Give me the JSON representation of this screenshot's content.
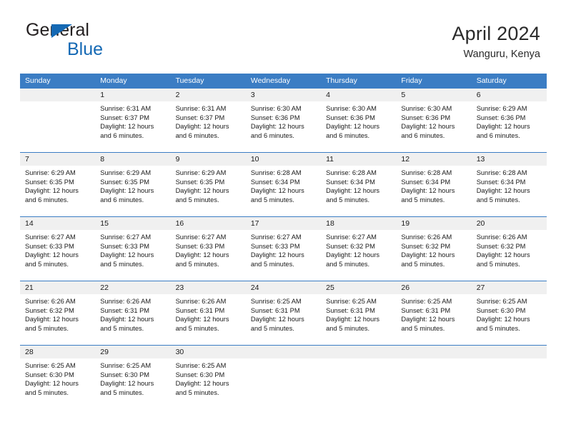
{
  "brand": {
    "name_part1": "General",
    "name_part2": "Blue",
    "accent_color": "#1569b4"
  },
  "header": {
    "title": "April 2024",
    "subtitle": "Wanguru, Kenya"
  },
  "theme": {
    "header_blue": "#3b7dc4",
    "date_band_gray": "#f0f0f0"
  },
  "weekday_headers": [
    "Sunday",
    "Monday",
    "Tuesday",
    "Wednesday",
    "Thursday",
    "Friday",
    "Saturday"
  ],
  "weeks": [
    {
      "days": [
        {
          "day": "",
          "sunrise": "",
          "sunset": "",
          "daylight_line1": "",
          "daylight_line2": "",
          "empty": true
        },
        {
          "day": "1",
          "sunrise": "Sunrise: 6:31 AM",
          "sunset": "Sunset: 6:37 PM",
          "daylight_line1": "Daylight: 12 hours",
          "daylight_line2": "and 6 minutes.",
          "empty": false
        },
        {
          "day": "2",
          "sunrise": "Sunrise: 6:31 AM",
          "sunset": "Sunset: 6:37 PM",
          "daylight_line1": "Daylight: 12 hours",
          "daylight_line2": "and 6 minutes.",
          "empty": false
        },
        {
          "day": "3",
          "sunrise": "Sunrise: 6:30 AM",
          "sunset": "Sunset: 6:36 PM",
          "daylight_line1": "Daylight: 12 hours",
          "daylight_line2": "and 6 minutes.",
          "empty": false
        },
        {
          "day": "4",
          "sunrise": "Sunrise: 6:30 AM",
          "sunset": "Sunset: 6:36 PM",
          "daylight_line1": "Daylight: 12 hours",
          "daylight_line2": "and 6 minutes.",
          "empty": false
        },
        {
          "day": "5",
          "sunrise": "Sunrise: 6:30 AM",
          "sunset": "Sunset: 6:36 PM",
          "daylight_line1": "Daylight: 12 hours",
          "daylight_line2": "and 6 minutes.",
          "empty": false
        },
        {
          "day": "6",
          "sunrise": "Sunrise: 6:29 AM",
          "sunset": "Sunset: 6:36 PM",
          "daylight_line1": "Daylight: 12 hours",
          "daylight_line2": "and 6 minutes.",
          "empty": false
        }
      ]
    },
    {
      "days": [
        {
          "day": "7",
          "sunrise": "Sunrise: 6:29 AM",
          "sunset": "Sunset: 6:35 PM",
          "daylight_line1": "Daylight: 12 hours",
          "daylight_line2": "and 6 minutes.",
          "empty": false
        },
        {
          "day": "8",
          "sunrise": "Sunrise: 6:29 AM",
          "sunset": "Sunset: 6:35 PM",
          "daylight_line1": "Daylight: 12 hours",
          "daylight_line2": "and 6 minutes.",
          "empty": false
        },
        {
          "day": "9",
          "sunrise": "Sunrise: 6:29 AM",
          "sunset": "Sunset: 6:35 PM",
          "daylight_line1": "Daylight: 12 hours",
          "daylight_line2": "and 5 minutes.",
          "empty": false
        },
        {
          "day": "10",
          "sunrise": "Sunrise: 6:28 AM",
          "sunset": "Sunset: 6:34 PM",
          "daylight_line1": "Daylight: 12 hours",
          "daylight_line2": "and 5 minutes.",
          "empty": false
        },
        {
          "day": "11",
          "sunrise": "Sunrise: 6:28 AM",
          "sunset": "Sunset: 6:34 PM",
          "daylight_line1": "Daylight: 12 hours",
          "daylight_line2": "and 5 minutes.",
          "empty": false
        },
        {
          "day": "12",
          "sunrise": "Sunrise: 6:28 AM",
          "sunset": "Sunset: 6:34 PM",
          "daylight_line1": "Daylight: 12 hours",
          "daylight_line2": "and 5 minutes.",
          "empty": false
        },
        {
          "day": "13",
          "sunrise": "Sunrise: 6:28 AM",
          "sunset": "Sunset: 6:34 PM",
          "daylight_line1": "Daylight: 12 hours",
          "daylight_line2": "and 5 minutes.",
          "empty": false
        }
      ]
    },
    {
      "days": [
        {
          "day": "14",
          "sunrise": "Sunrise: 6:27 AM",
          "sunset": "Sunset: 6:33 PM",
          "daylight_line1": "Daylight: 12 hours",
          "daylight_line2": "and 5 minutes.",
          "empty": false
        },
        {
          "day": "15",
          "sunrise": "Sunrise: 6:27 AM",
          "sunset": "Sunset: 6:33 PM",
          "daylight_line1": "Daylight: 12 hours",
          "daylight_line2": "and 5 minutes.",
          "empty": false
        },
        {
          "day": "16",
          "sunrise": "Sunrise: 6:27 AM",
          "sunset": "Sunset: 6:33 PM",
          "daylight_line1": "Daylight: 12 hours",
          "daylight_line2": "and 5 minutes.",
          "empty": false
        },
        {
          "day": "17",
          "sunrise": "Sunrise: 6:27 AM",
          "sunset": "Sunset: 6:33 PM",
          "daylight_line1": "Daylight: 12 hours",
          "daylight_line2": "and 5 minutes.",
          "empty": false
        },
        {
          "day": "18",
          "sunrise": "Sunrise: 6:27 AM",
          "sunset": "Sunset: 6:32 PM",
          "daylight_line1": "Daylight: 12 hours",
          "daylight_line2": "and 5 minutes.",
          "empty": false
        },
        {
          "day": "19",
          "sunrise": "Sunrise: 6:26 AM",
          "sunset": "Sunset: 6:32 PM",
          "daylight_line1": "Daylight: 12 hours",
          "daylight_line2": "and 5 minutes.",
          "empty": false
        },
        {
          "day": "20",
          "sunrise": "Sunrise: 6:26 AM",
          "sunset": "Sunset: 6:32 PM",
          "daylight_line1": "Daylight: 12 hours",
          "daylight_line2": "and 5 minutes.",
          "empty": false
        }
      ]
    },
    {
      "days": [
        {
          "day": "21",
          "sunrise": "Sunrise: 6:26 AM",
          "sunset": "Sunset: 6:32 PM",
          "daylight_line1": "Daylight: 12 hours",
          "daylight_line2": "and 5 minutes.",
          "empty": false
        },
        {
          "day": "22",
          "sunrise": "Sunrise: 6:26 AM",
          "sunset": "Sunset: 6:31 PM",
          "daylight_line1": "Daylight: 12 hours",
          "daylight_line2": "and 5 minutes.",
          "empty": false
        },
        {
          "day": "23",
          "sunrise": "Sunrise: 6:26 AM",
          "sunset": "Sunset: 6:31 PM",
          "daylight_line1": "Daylight: 12 hours",
          "daylight_line2": "and 5 minutes.",
          "empty": false
        },
        {
          "day": "24",
          "sunrise": "Sunrise: 6:25 AM",
          "sunset": "Sunset: 6:31 PM",
          "daylight_line1": "Daylight: 12 hours",
          "daylight_line2": "and 5 minutes.",
          "empty": false
        },
        {
          "day": "25",
          "sunrise": "Sunrise: 6:25 AM",
          "sunset": "Sunset: 6:31 PM",
          "daylight_line1": "Daylight: 12 hours",
          "daylight_line2": "and 5 minutes.",
          "empty": false
        },
        {
          "day": "26",
          "sunrise": "Sunrise: 6:25 AM",
          "sunset": "Sunset: 6:31 PM",
          "daylight_line1": "Daylight: 12 hours",
          "daylight_line2": "and 5 minutes.",
          "empty": false
        },
        {
          "day": "27",
          "sunrise": "Sunrise: 6:25 AM",
          "sunset": "Sunset: 6:30 PM",
          "daylight_line1": "Daylight: 12 hours",
          "daylight_line2": "and 5 minutes.",
          "empty": false
        }
      ]
    },
    {
      "days": [
        {
          "day": "28",
          "sunrise": "Sunrise: 6:25 AM",
          "sunset": "Sunset: 6:30 PM",
          "daylight_line1": "Daylight: 12 hours",
          "daylight_line2": "and 5 minutes.",
          "empty": false
        },
        {
          "day": "29",
          "sunrise": "Sunrise: 6:25 AM",
          "sunset": "Sunset: 6:30 PM",
          "daylight_line1": "Daylight: 12 hours",
          "daylight_line2": "and 5 minutes.",
          "empty": false
        },
        {
          "day": "30",
          "sunrise": "Sunrise: 6:25 AM",
          "sunset": "Sunset: 6:30 PM",
          "daylight_line1": "Daylight: 12 hours",
          "daylight_line2": "and 5 minutes.",
          "empty": false
        },
        {
          "day": "",
          "sunrise": "",
          "sunset": "",
          "daylight_line1": "",
          "daylight_line2": "",
          "empty": true
        },
        {
          "day": "",
          "sunrise": "",
          "sunset": "",
          "daylight_line1": "",
          "daylight_line2": "",
          "empty": true
        },
        {
          "day": "",
          "sunrise": "",
          "sunset": "",
          "daylight_line1": "",
          "daylight_line2": "",
          "empty": true
        },
        {
          "day": "",
          "sunrise": "",
          "sunset": "",
          "daylight_line1": "",
          "daylight_line2": "",
          "empty": true
        }
      ]
    }
  ]
}
